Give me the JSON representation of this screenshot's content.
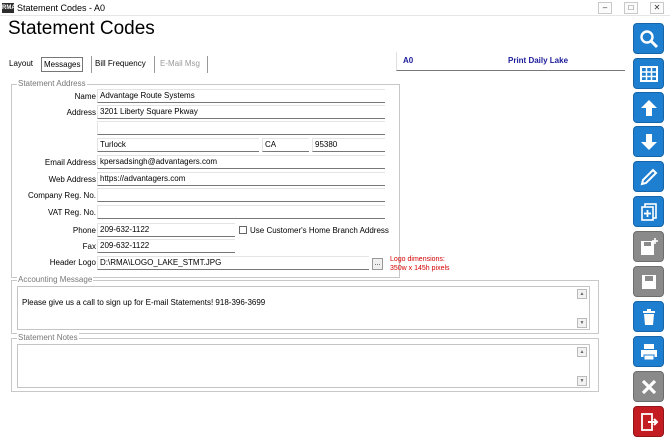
{
  "window": {
    "title": "Statement Codes - A0",
    "app_icon_text": "RMA"
  },
  "page": {
    "title": "Statement Codes"
  },
  "tabs": [
    {
      "label": "Layout"
    },
    {
      "label": "Messages"
    },
    {
      "label": "Bill Frequency"
    },
    {
      "label": "E-Mail Msg"
    }
  ],
  "header": {
    "code": "A0",
    "name": "Print Daily Lake"
  },
  "address_section": {
    "title": "Statement Address",
    "name_label": "Name",
    "name": "Advantage Route Systems",
    "address_label": "Address",
    "address1": "3201 Liberty Square Pkway",
    "address2": "",
    "city": "Turlock",
    "state": "CA",
    "zip": "95380",
    "email_label": "Email Address",
    "email": "kpersadsingh@advantagers.com",
    "web_label": "Web Address",
    "web": "https://advantagers.com",
    "company_reg_label": "Company Reg. No.",
    "company_reg": "",
    "vat_label": "VAT Reg. No.",
    "vat": "",
    "phone_label": "Phone",
    "phone": "209-632-1122",
    "use_branch_label": "Use Customer's Home Branch Address",
    "use_branch_checked": false,
    "fax_label": "Fax",
    "fax": "209-632-1122",
    "logo_label": "Header Logo",
    "logo": "D:\\RMA\\LOGO_LAKE_STMT.JPG",
    "logo_note_line1": "Logo dimensions:",
    "logo_note_line2": "350w x 145h pixels"
  },
  "accounting_section": {
    "title": "Accounting Message",
    "message": "Please give us a call to sign up for E-mail Statements! 918-396-3699"
  },
  "notes_section": {
    "title": "Statement Notes",
    "notes": ""
  },
  "sidebar_buttons": [
    {
      "icon": "search-icon",
      "color": "#1e7fd0"
    },
    {
      "icon": "grid-icon",
      "color": "#1e7fd0"
    },
    {
      "icon": "arrow-up-icon",
      "color": "#1e7fd0"
    },
    {
      "icon": "arrow-down-icon",
      "color": "#1e7fd0"
    },
    {
      "icon": "pencil-icon",
      "color": "#1e7fd0"
    },
    {
      "icon": "new-document-icon",
      "color": "#1e7fd0"
    },
    {
      "icon": "save-as-icon",
      "color": "#8a8a8a"
    },
    {
      "icon": "save-icon",
      "color": "#8a8a8a"
    },
    {
      "icon": "trash-icon",
      "color": "#1e7fd0"
    },
    {
      "icon": "print-icon",
      "color": "#1e7fd0"
    },
    {
      "icon": "cancel-icon",
      "color": "#8a8a8a"
    },
    {
      "icon": "exit-icon",
      "color": "#c31c22"
    }
  ]
}
